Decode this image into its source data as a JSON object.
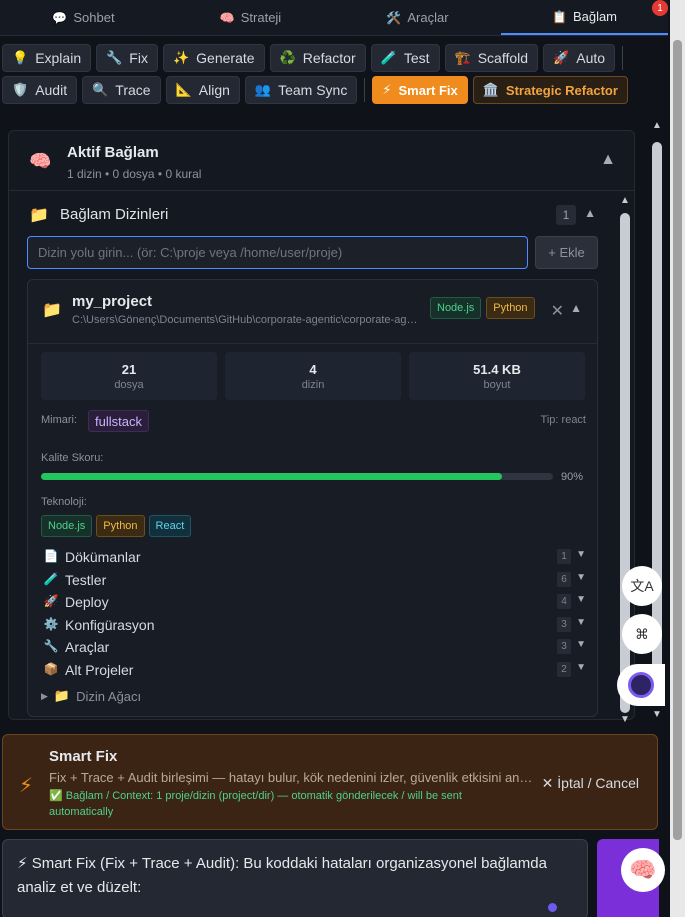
{
  "tabs": [
    {
      "icon": "💬",
      "label": "Sohbet"
    },
    {
      "icon": "🧠",
      "label": "Strateji"
    },
    {
      "icon": "🛠️",
      "label": "Araçlar"
    },
    {
      "icon": "📋",
      "label": "Bağlam"
    }
  ],
  "notification_count": "1",
  "toolbar": {
    "row1": [
      {
        "icon": "💡",
        "label": "Explain"
      },
      {
        "icon": "🔧",
        "label": "Fix"
      },
      {
        "icon": "✨",
        "label": "Generate"
      },
      {
        "icon": "♻️",
        "label": "Refactor"
      },
      {
        "icon": "🧪",
        "label": "Test"
      },
      {
        "icon": "🏗️",
        "label": "Scaffold"
      },
      {
        "icon": "🚀",
        "label": "Auto"
      }
    ],
    "row2": [
      {
        "icon": "🛡️",
        "label": "Audit"
      },
      {
        "icon": "🔍",
        "label": "Trace"
      },
      {
        "icon": "📐",
        "label": "Align"
      },
      {
        "icon": "👥",
        "label": "Team Sync"
      }
    ],
    "smart_fix": {
      "icon": "⚡",
      "label": "Smart Fix"
    },
    "strategic_refactor": {
      "icon": "🏛️",
      "label": "Strategic Refactor"
    }
  },
  "context": {
    "title": "Aktif Bağlam",
    "subtitle": "1 dizin • 0 dosya • 0 kural",
    "dirs_label": "Bağlam Dizinleri",
    "dirs_count": "1",
    "dir_placeholder": "Dizin yolu girin... (ör: C:\\proje veya /home/user/proje)",
    "add_label": "+ Ekle"
  },
  "project": {
    "name": "my_project",
    "path": "C:\\Users\\Gönenç\\Documents\\GitHub\\corporate-agentic\\corporate-agentic",
    "badges": [
      "Node.js",
      "Python"
    ],
    "stats": [
      {
        "value": "21",
        "label": "dosya"
      },
      {
        "value": "4",
        "label": "dizin"
      },
      {
        "value": "51.4 KB",
        "label": "boyut"
      }
    ],
    "arch_label": "Mimari:",
    "arch_value": "fullstack",
    "type_label": "Tip: react",
    "quality_label": "Kalite Skoru:",
    "quality_value": 0.9,
    "quality_pct": "90%",
    "tech_label": "Teknoloji:",
    "tech": [
      "Node.js",
      "Python",
      "React"
    ],
    "sections": [
      {
        "icon": "📄",
        "label": "Dökümanlar",
        "count": "1"
      },
      {
        "icon": "🧪",
        "label": "Testler",
        "count": "6"
      },
      {
        "icon": "🚀",
        "label": "Deploy",
        "count": "4"
      },
      {
        "icon": "⚙️",
        "label": "Konfigürasyon",
        "count": "3"
      },
      {
        "icon": "🔧",
        "label": "Araçlar",
        "count": "3"
      },
      {
        "icon": "📦",
        "label": "Alt Projeler",
        "count": "2"
      }
    ],
    "tree_label": "Dizin Ağacı"
  },
  "banner": {
    "title": "Smart Fix",
    "desc": "Fix + Trace + Audit birleşimi — hatayı bulur, kök nedenini izler, güvenlik etkisini analiz eder",
    "ctx": "✅ Bağlam / Context: 1 proje/dizin (project/dir) — otomatik gönderilecek / will be sent automatically",
    "cancel": "✕ İptal / Cancel"
  },
  "chat": {
    "text": "⚡ Smart Fix (Fix + Trace + Audit): Bu koddaki hataları organizasyonel bağlamda analiz et ve düzelt:"
  }
}
